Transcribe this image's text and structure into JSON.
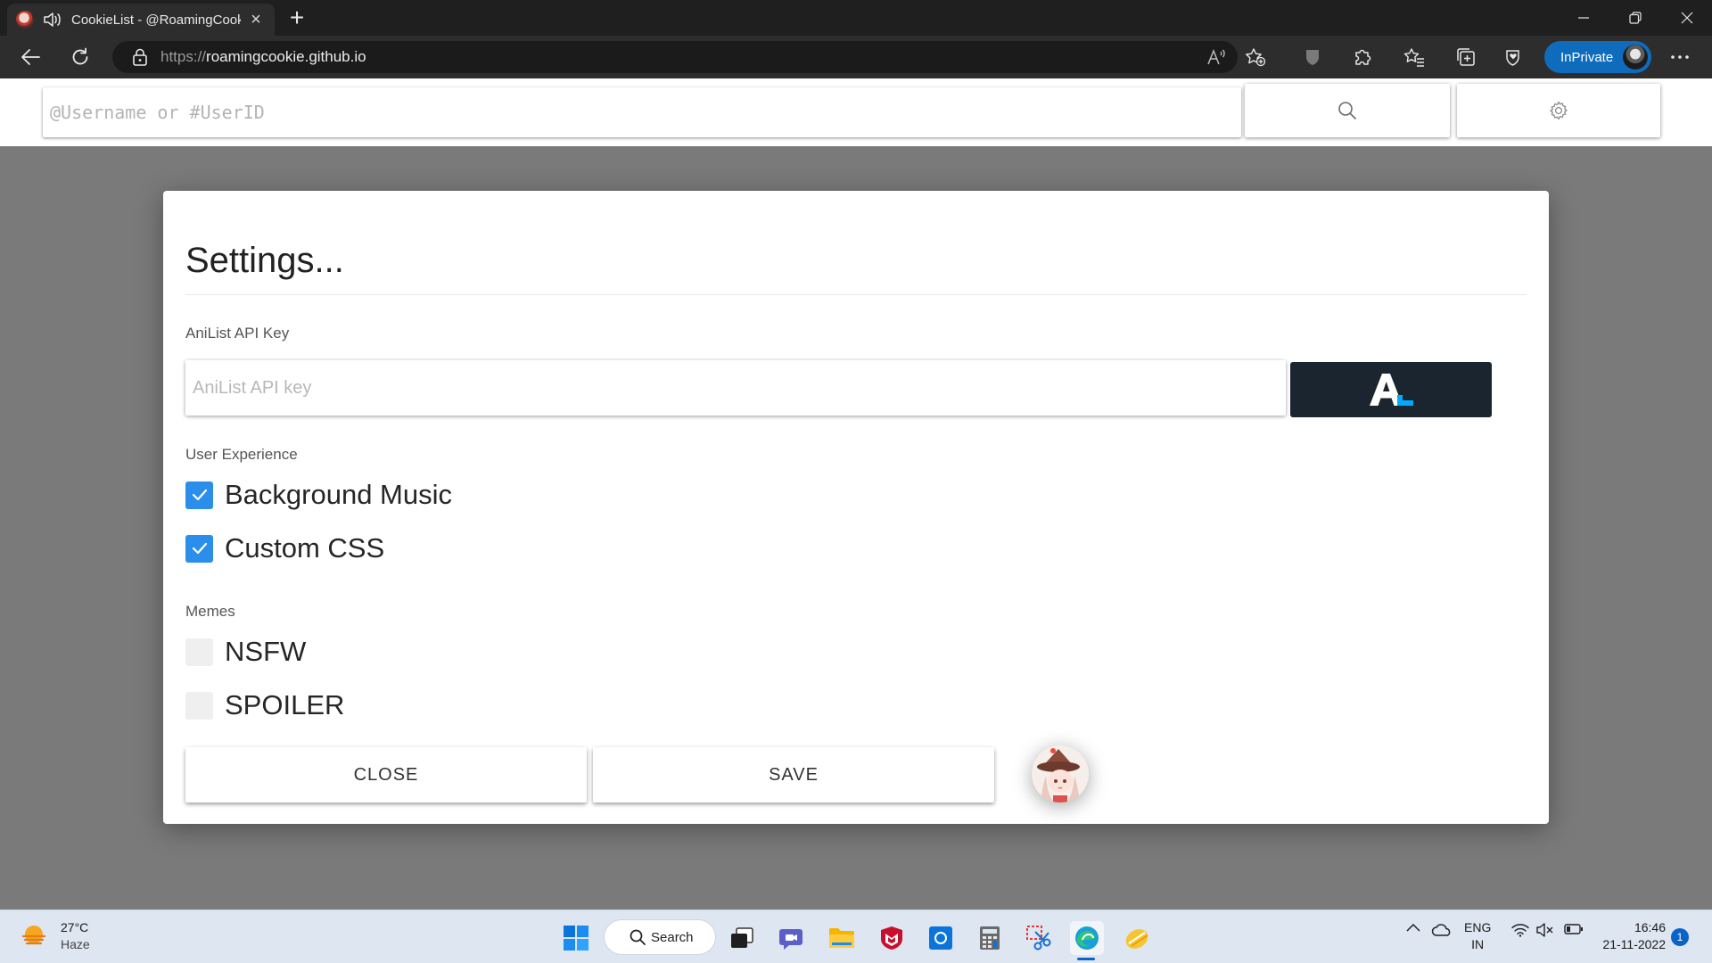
{
  "browser": {
    "tab_title": "CookieList - @RoamingCookie",
    "url_prefix": "https://",
    "url_host": "roamingcookie.github.io",
    "inprivate_label": "InPrivate"
  },
  "topbar": {
    "user_search_placeholder": "@Username or #UserID"
  },
  "settings": {
    "title": "Settings...",
    "api_key_label": "AniList API Key",
    "api_key_placeholder": "AniList API key",
    "api_key_value": "",
    "anilist_logo": "AL",
    "user_experience_label": "User Experience",
    "user_experience": [
      {
        "label": "Background Music",
        "checked": true
      },
      {
        "label": "Custom CSS",
        "checked": true
      }
    ],
    "memes_label": "Memes",
    "memes": [
      {
        "label": "NSFW",
        "checked": false
      },
      {
        "label": "SPOILER",
        "checked": false
      }
    ],
    "close_label": "CLOSE",
    "save_label": "SAVE"
  },
  "taskbar": {
    "temperature": "27°C",
    "condition": "Haze",
    "search_label": "Search",
    "lang_line1": "ENG",
    "lang_line2": "IN",
    "time": "16:46",
    "date": "21-11-2022",
    "notification_count": "1"
  },
  "colors": {
    "accent_blue": "#2b8eea",
    "anilist_dark": "#1b2530",
    "inprivate_blue": "#0f6cbd"
  }
}
